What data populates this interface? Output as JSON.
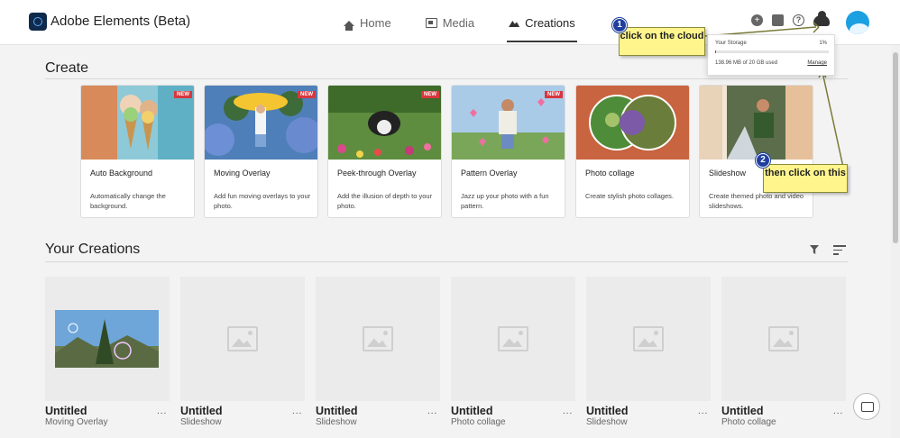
{
  "app": {
    "title": "Adobe Elements (Beta)"
  },
  "nav": [
    {
      "label": "Home",
      "icon": "home-icon"
    },
    {
      "label": "Media",
      "icon": "media-icon"
    },
    {
      "label": "Creations",
      "icon": "creations-icon",
      "active": true
    }
  ],
  "header_icons": [
    "add-icon",
    "share-icon",
    "help-icon",
    "cloud-icon"
  ],
  "help_glyph": "?",
  "storage": {
    "title": "Your Storage",
    "percent": "1%",
    "used_fraction": 0.01,
    "used_text": "138.96 MB of 20 GB used",
    "manage_label": "Manage"
  },
  "annotations": {
    "step1": {
      "number": "1",
      "text": "click on the cloud"
    },
    "step2": {
      "number": "2",
      "text": "then click on this"
    }
  },
  "create": {
    "title": "Create",
    "new_label": "NEW",
    "cards": [
      {
        "title": "Auto Background",
        "desc": "Automatically change the background.",
        "is_new": true
      },
      {
        "title": "Moving Overlay",
        "desc": "Add fun moving overlays to your photo.",
        "is_new": true
      },
      {
        "title": "Peek-through Overlay",
        "desc": "Add the illusion of depth to your photo.",
        "is_new": true
      },
      {
        "title": "Pattern Overlay",
        "desc": "Jazz up your photo with a fun pattern.",
        "is_new": true
      },
      {
        "title": "Photo collage",
        "desc": "Create stylish photo collages.",
        "is_new": false
      },
      {
        "title": "Slideshow",
        "desc": "Create themed photo and video slideshows.",
        "is_new": false
      }
    ]
  },
  "your_creations": {
    "title": "Your Creations",
    "more_label": "...",
    "items": [
      {
        "title": "Untitled",
        "type": "Moving Overlay",
        "has_preview": true
      },
      {
        "title": "Untitled",
        "type": "Slideshow",
        "has_preview": false
      },
      {
        "title": "Untitled",
        "type": "Slideshow",
        "has_preview": false
      },
      {
        "title": "Untitled",
        "type": "Photo collage",
        "has_preview": false
      },
      {
        "title": "Untitled",
        "type": "Slideshow",
        "has_preview": false
      },
      {
        "title": "Untitled",
        "type": "Photo collage",
        "has_preview": false
      }
    ]
  },
  "colors": {
    "accent": "#1473e6",
    "new_badge": "#d7373f",
    "callout": "#fff58c",
    "step_badge": "#1f3f9e"
  }
}
